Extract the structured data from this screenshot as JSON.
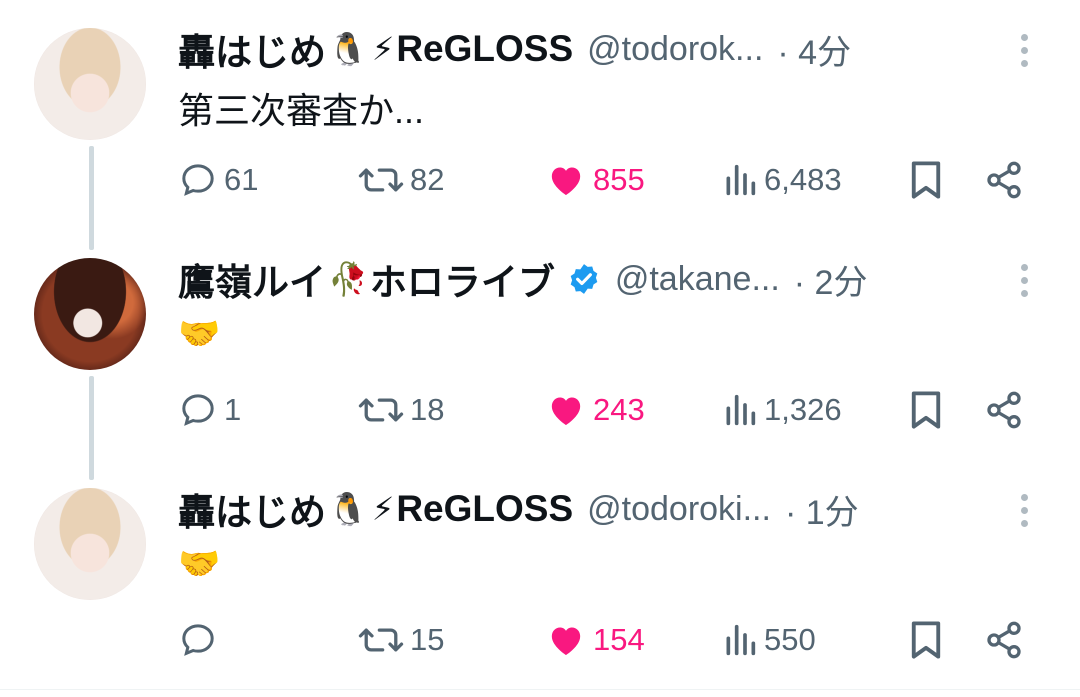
{
  "tweets": [
    {
      "name": "轟はじめ",
      "name_emoji_1": "🐧",
      "name_emoji_2": "⚡",
      "name_suffix": "ReGLOSS",
      "handle": "@todorok...",
      "time": "· 4分",
      "text": "第三次審査か...",
      "verified": false,
      "replies": "61",
      "retweets": "82",
      "likes": "855",
      "views": "6,483"
    },
    {
      "name": "鷹嶺ルイ",
      "name_emoji_1": "🥀",
      "name_emoji_2": "",
      "name_suffix": "ホロライブ",
      "handle": "@takane...",
      "time": "· 2分",
      "text": "🤝",
      "verified": true,
      "replies": "1",
      "retweets": "18",
      "likes": "243",
      "views": "1,326"
    },
    {
      "name": "轟はじめ",
      "name_emoji_1": "🐧",
      "name_emoji_2": "⚡",
      "name_suffix": "ReGLOSS",
      "handle": "@todoroki...",
      "time": "· 1分",
      "text": "🤝",
      "verified": false,
      "replies": "",
      "retweets": "15",
      "likes": "154",
      "views": "550"
    }
  ],
  "colors": {
    "like": "#f91880",
    "secondary": "#536471",
    "verified": "#1d9bf0",
    "thread_line": "#cfd9de"
  },
  "icons": [
    "reply-icon",
    "retweet-icon",
    "like-icon",
    "views-icon",
    "bookmark-icon",
    "share-icon",
    "more-icon",
    "verified-icon"
  ]
}
